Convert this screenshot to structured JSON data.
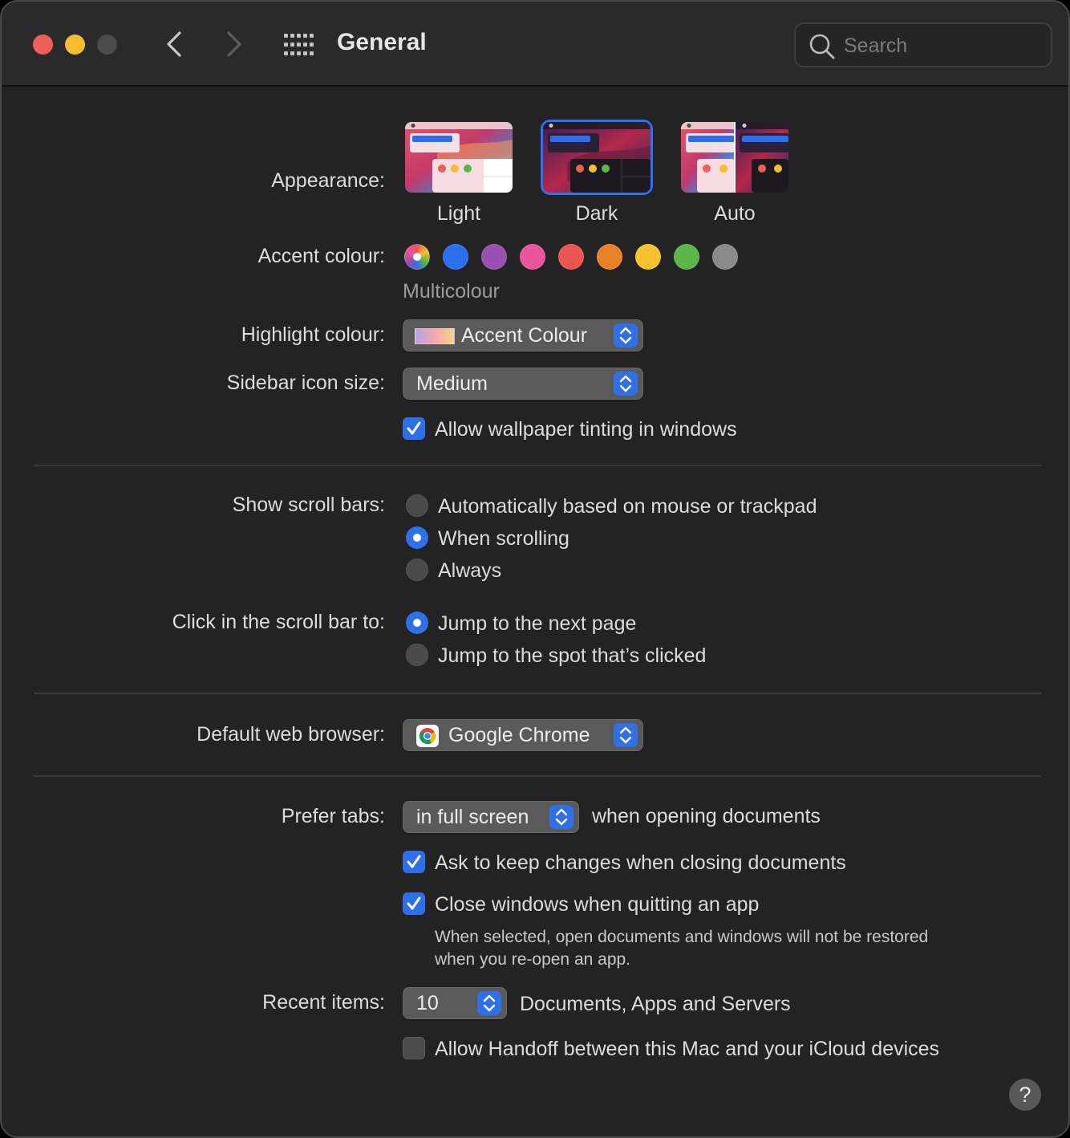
{
  "window": {
    "title": "General",
    "search_placeholder": "Search"
  },
  "appearance": {
    "label": "Appearance:",
    "options": [
      "Light",
      "Dark",
      "Auto"
    ],
    "selected": "Dark"
  },
  "accent": {
    "label": "Accent colour:",
    "selected_name": "Multicolour",
    "colors": [
      "multicolour",
      "#2b6ff0",
      "#9a4fb0",
      "#e8559a",
      "#ed5550",
      "#e98128",
      "#f6c12f",
      "#5cb548",
      "#8b8b8b"
    ]
  },
  "highlight": {
    "label": "Highlight colour:",
    "value": "Accent Colour"
  },
  "sidebar_icon_size": {
    "label": "Sidebar icon size:",
    "value": "Medium"
  },
  "wallpaper_tinting": {
    "label": "Allow wallpaper tinting in windows",
    "checked": true
  },
  "scroll_bars": {
    "label": "Show scroll bars:",
    "options": [
      "Automatically based on mouse or trackpad",
      "When scrolling",
      "Always"
    ],
    "selected_index": 1
  },
  "click_scroll_bar": {
    "label": "Click in the scroll bar to:",
    "options": [
      "Jump to the next page",
      "Jump to the spot that’s clicked"
    ],
    "selected_index": 0
  },
  "browser": {
    "label": "Default web browser:",
    "value": "Google Chrome"
  },
  "prefer_tabs": {
    "label": "Prefer tabs:",
    "value": "in full screen",
    "suffix": "when opening documents"
  },
  "ask_keep_changes": {
    "label": "Ask to keep changes when closing documents",
    "checked": true
  },
  "close_windows": {
    "label": "Close windows when quitting an app",
    "checked": true,
    "note_line1": "When selected, open documents and windows will not be restored",
    "note_line2": "when you re-open an app."
  },
  "recent_items": {
    "label": "Recent items:",
    "value": "10",
    "suffix": "Documents, Apps and Servers"
  },
  "handoff": {
    "label": "Allow Handoff between this Mac and your iCloud devices",
    "checked": false
  },
  "help": {
    "glyph": "?"
  }
}
